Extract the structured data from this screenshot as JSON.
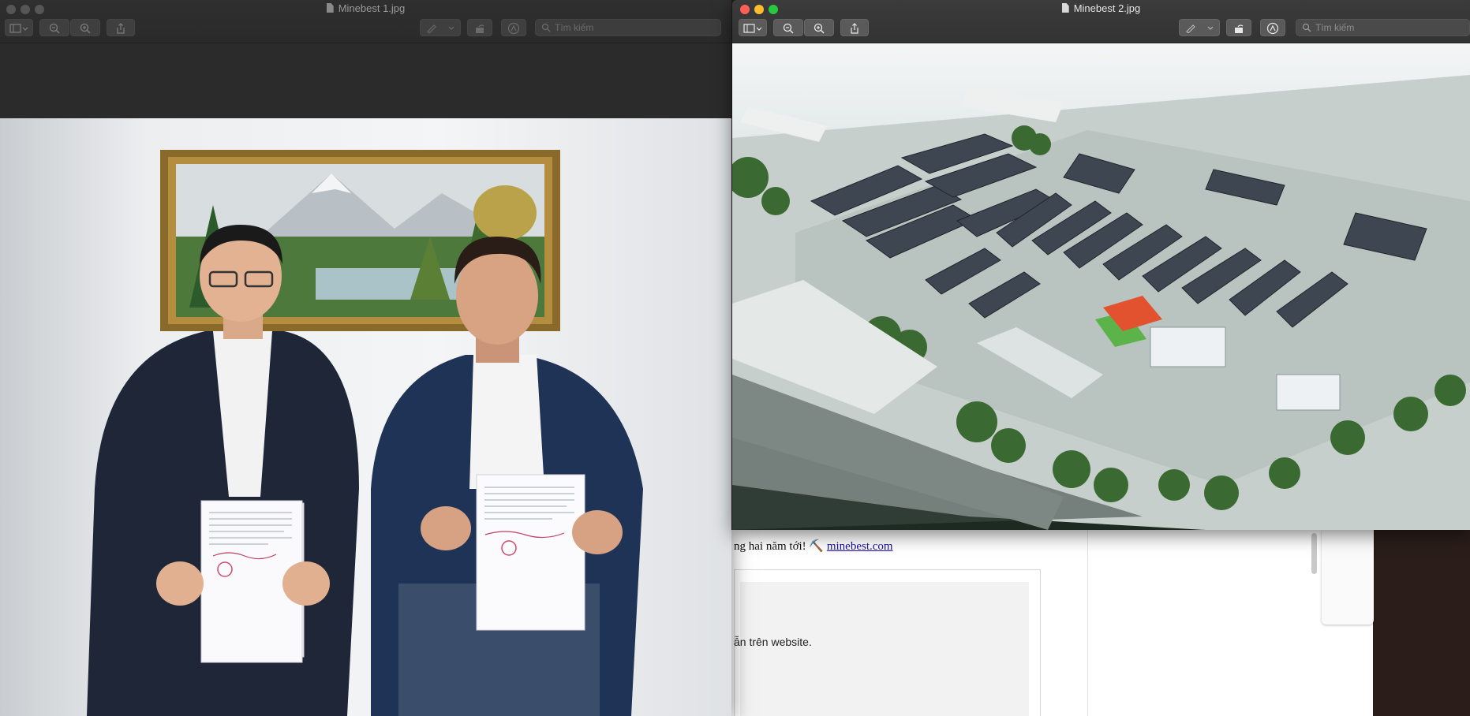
{
  "background_page": {
    "line1_text": "ng hai năm tới! ⛏️",
    "line1_link": "minebest.com",
    "line2_text": "ẫn trên website."
  },
  "window1": {
    "title": "Minebest 1.jpg",
    "search_placeholder": "Tìm kiếm",
    "image_name": "meeting-photo"
  },
  "window2": {
    "title": "Minebest 2.jpg",
    "search_placeholder": "Tìm kiếm",
    "image_name": "factory-aerial-render"
  },
  "colors": {
    "close": "#ff5f57",
    "minimize": "#febc2e",
    "zoom": "#28c840",
    "roof": "#3d4651",
    "court": "#e2522e",
    "grass": "#5cb34a",
    "suit": "#1f2b40"
  }
}
